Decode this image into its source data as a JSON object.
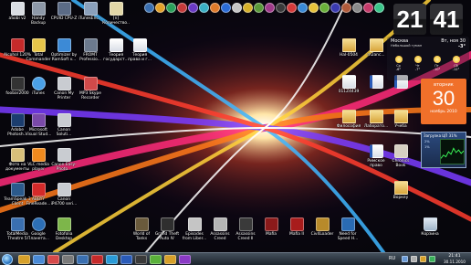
{
  "desktop_icons": {
    "asobi": "aSobi v2",
    "handy_backup": "Handy Backup",
    "cpuid": "CPUID CPU-Z",
    "itunes_enc": "iTunesEnc...",
    "alcohol": "Alcohol 120%",
    "total_commander": "Total Commander",
    "optimizer": "Optimizer by RamSoft v...",
    "fromt": "FROMT Professio...",
    "teoria_gos": "Теория государст...",
    "teoria_prava": "Теория права и г...",
    "foobar": "foobar2000",
    "itunes": "iTunes",
    "canon_my_printer": "Canon My Printer",
    "mp3_skype": "MP3 Skype Recorder",
    "adobe_photoshop": "Adobe Photosh...",
    "ms_visual_studio": "Microsoft Visual Stud...",
    "canon_solution": "Canon Soluti...",
    "foto_na": "Фото на документы",
    "vlc": "VLC media player",
    "canon_easy": "Canon Easy-Photo...",
    "teamspeak": "TeamSpeak 3 Client",
    "abbyy": "ABBYY FineReade...",
    "canon_ip4700": "Canon iP4700 seri...",
    "totalmedia": "TotalMedia Theatre 5",
    "google_earth": "Google Планета...",
    "fotofolia": "Fotofolia Desktop",
    "kolichestvo": "[n] Количество...",
    "world_of_tanks": "World of Tanks",
    "gta4": "Grand Theft Auto IV",
    "episodes": "Episodes from Liber...",
    "ac1": "Assassins Creed",
    "ac2": "Assassins Creed II",
    "mafia": "Mafia",
    "mafia2": "Mafia II",
    "civ4": "Civ4Loader",
    "nfs": "Need for Speed H...",
    "hal": "Hal-0504",
    "m2anc": "m2anc...",
    "t_0114": "011Z4439",
    "filosofia": "Философия",
    "laborato": "Лаборато...",
    "ucheba": "Учеба",
    "rimskoe": "Римское право",
    "chronics": "Chronics Book",
    "vorkeit": "Воркеу",
    "trash": "Корзина"
  },
  "clock": {
    "hours": "21",
    "minutes": "41"
  },
  "weather": {
    "city": "Москва",
    "condition": "Небольшой туман",
    "date": "Вт, ноя 30",
    "temp": "-3°",
    "forecast": [
      {
        "day": "Ср",
        "temp": "-6°"
      },
      {
        "day": "Чт",
        "temp": "-7°"
      },
      {
        "day": "Пт",
        "temp": "-10°"
      },
      {
        "day": "Сб",
        "temp": "-12°"
      }
    ]
  },
  "calendar": {
    "weekday": "вторник",
    "day": "30",
    "month_year": "ноябрь 2010"
  },
  "cpu_meter": {
    "header": "Загрузка ЦП 31%",
    "line1": "2%",
    "line2": "1%"
  },
  "taskbar": {
    "lang": "RU",
    "time": "21:41",
    "date": "30.11.2010"
  },
  "colors": {
    "calendar": "#f0702a",
    "taskbar": "#1b232c"
  }
}
